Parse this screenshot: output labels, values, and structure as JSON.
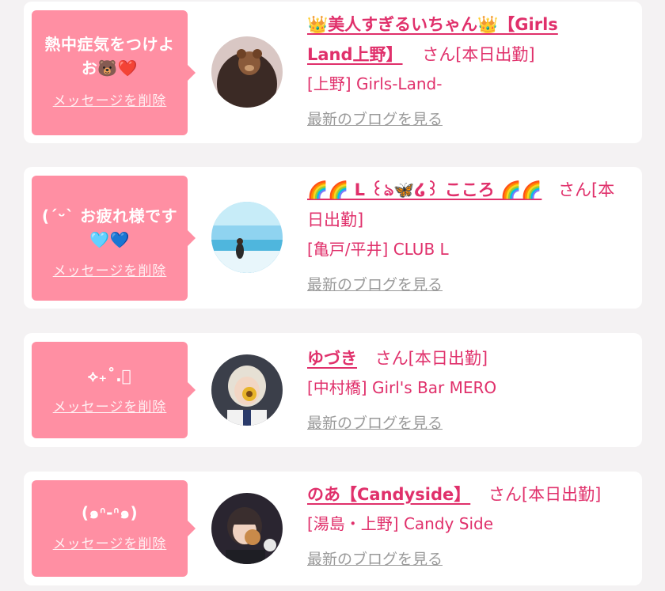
{
  "colors": {
    "accent": "#e0306b",
    "bubble": "#ff8fa3",
    "link_gray": "#9a9a9a"
  },
  "delete_label": "メッセージを削除",
  "blog_label": "最新のブログを見る",
  "entries": [
    {
      "message_line1": "熱中症気をつけよ",
      "message_line2": "お🐻❤️",
      "name_line1": "👑美人すぎるいちゃん👑【Girls",
      "name_line2": "Land上野】",
      "san": "さん[本日出勤]",
      "shop": "[上野] Girls-Land-"
    },
    {
      "message_line1": "(ˊᵕˋ お疲れ様です",
      "message_line2": "🩵💙",
      "name_line1": "🌈🌈 L ꒰ঌ🦋໒꒱ こころ 🌈🌈",
      "san_line1": "さん[本",
      "san_line2": "日出勤]",
      "shop": "[亀戸/平井] CLUB L"
    },
    {
      "message_line1": "⟡₊˚.ﾟ",
      "name_line1": "ゆづき",
      "san": "さん[本日出勤]",
      "shop": "[中村橋] Girl's Bar MERO"
    },
    {
      "message_line1": "(๑ᐢ-ᐢ๑)",
      "name_line1": "のあ【Candyside】",
      "san": "さん[本日出勤]",
      "shop": "[湯島・上野] Candy Side"
    }
  ]
}
